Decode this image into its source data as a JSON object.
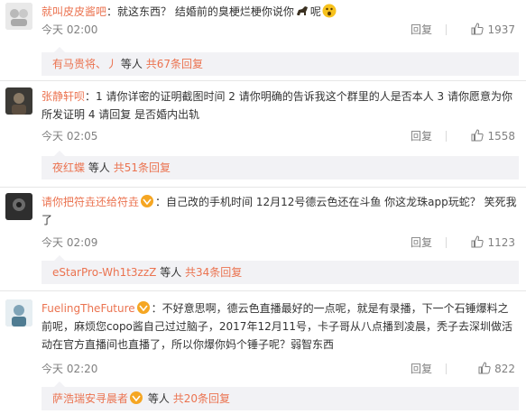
{
  "comments": [
    {
      "username": "就叫皮皮酱吧",
      "text_a": "：就这东西？ 结婚前的臭梗烂梗你说你",
      "text_b": "呢",
      "time": "今天 02:00",
      "reply_label": "回复",
      "likes": "1937",
      "sub_user": "有马贵将、丿",
      "sub_mid": "等人",
      "sub_more": "共67条回复"
    },
    {
      "username": "张静轩呗",
      "text_a": "：1 请你详密的证明截图时间 2 请你明确的告诉我这个群里的人是否本人 3 请你愿意为你所发证明  4 请回复 是否婚内出轨",
      "time": "今天 02:05",
      "reply_label": "回复",
      "likes": "1558",
      "sub_user": "夜红蝶",
      "sub_mid": "等人",
      "sub_more": "共51条回复"
    },
    {
      "username": "请你把符垚还给符垚",
      "text_a": "：自己改的手机时间 12月12号德云色还在斗鱼 你这龙珠app玩蛇？ 笑死我了",
      "time": "今天 02:09",
      "reply_label": "回复",
      "likes": "1123",
      "sub_user": "eStarPro-Wh1t3zzZ",
      "sub_mid": "等人",
      "sub_more": "共34条回复"
    },
    {
      "username": "FuelingTheFuture",
      "text_a": "：不好意思啊，德云色直播最好的一点呢，就是有录播，下一个石锤爆料之前呢，麻烦您copo酱自己过过脑子，2017年12月11号，卡子哥从八点播到凌晨，秃子去深圳做活动在官方直播间也直播了，所以你爆你妈个锤子呢？弱智东西",
      "time": "今天 02:20",
      "reply_label": "回复",
      "likes": "822",
      "sub_user": "萨浩瑞安寻晨者",
      "sub_mid": "等人",
      "sub_more": "共20条回复"
    }
  ],
  "colors": {
    "accent": "#eb7350",
    "muted": "#808080",
    "subbar": "#f2f2f5"
  },
  "icons": [
    "avatar",
    "horse-emoji",
    "surprised-emoji",
    "vip-badge-icon",
    "thumbs-up-icon"
  ]
}
